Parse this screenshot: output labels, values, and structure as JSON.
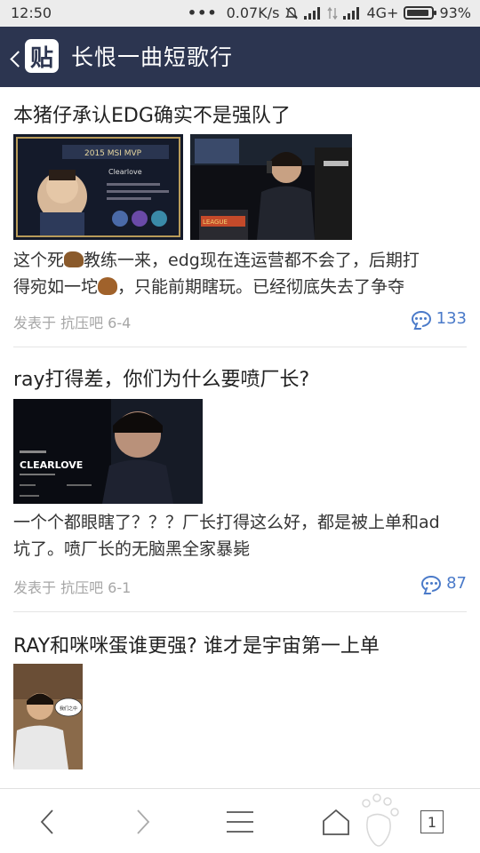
{
  "status_bar": {
    "time": "12:50",
    "network_speed": "0.07K/s",
    "network_type": "4G+",
    "battery": "93%",
    "battery_level": 0.93
  },
  "header": {
    "logo_char": "贴",
    "title": "长恨一曲短歌行",
    "background": "#2c3550"
  },
  "posts": [
    {
      "title": "本猪仔承认EDG确实不是强队了",
      "images": [
        "msi-mvp-clearlove-graphic",
        "player-at-gaming-booth-photo"
      ],
      "excerpt_line1_a": "这个死",
      "excerpt_line1_b": "教练一来，edg现在连运营都不会了，后期打",
      "excerpt_line2_a": "得宛如一坨",
      "excerpt_line2_b": "，只能前期瞎玩。已经彻底失去了争夺",
      "meta": "发表于 抗压吧 6-4",
      "comment_count": "133"
    },
    {
      "title": "ray打得差，你们为什么要喷厂长?",
      "images": [
        "clearlove-player-card"
      ],
      "excerpt_line1": "一个个都眼瞎了？？？厂长打得这么好，都是被上单和ad",
      "excerpt_line2": "坑了。喷厂长的无脑黑全家暴毙",
      "meta": "发表于 抗压吧 6-1",
      "comment_count": "87"
    },
    {
      "title": "RAY和咪咪蛋谁更强? 谁才是宇宙第一上单",
      "images": [
        "man-with-speech-bubble-meme"
      ],
      "thumb_bubble_text": "我们之中"
    }
  ],
  "bottom_nav": {
    "tab_count": "1",
    "accent": "#4a7ac9"
  }
}
